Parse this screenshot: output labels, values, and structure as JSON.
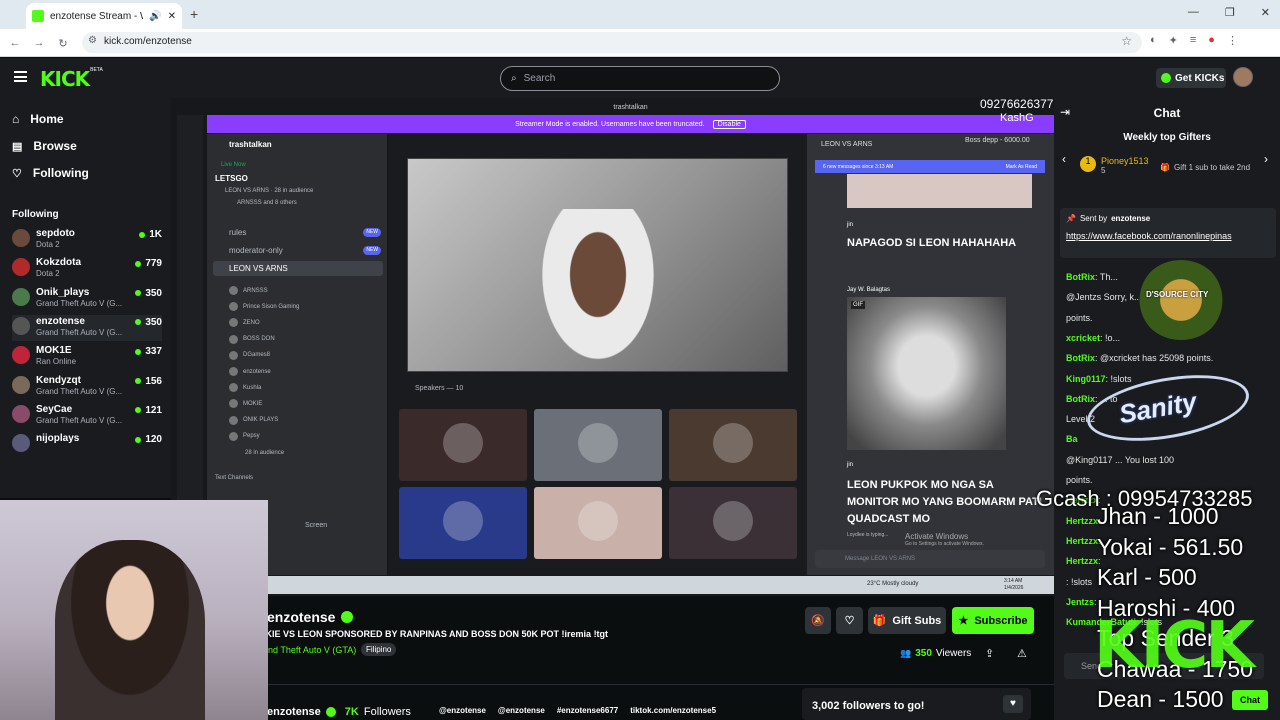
{
  "browser": {
    "tab_title": "enzotense Stream - Watch L",
    "url": "kick.com/enzotense"
  },
  "header": {
    "logo": "KICK",
    "logo_sup": "BETA",
    "search_placeholder": "Search",
    "get_kicks": "Get KICKs"
  },
  "sidebar": {
    "nav": [
      {
        "label": "Home",
        "icon": "home-icon"
      },
      {
        "label": "Browse",
        "icon": "browse-icon"
      },
      {
        "label": "Following",
        "icon": "heart-icon"
      }
    ],
    "following_title": "Following",
    "following": [
      {
        "name": "sepdoto",
        "game": "Dota 2",
        "viewers": "1K",
        "color": "#6a4a3a"
      },
      {
        "name": "Kokzdota",
        "game": "Dota 2",
        "viewers": "779",
        "color": "#b02a2a"
      },
      {
        "name": "Onik_plays",
        "game": "Grand Theft Auto V (G...",
        "viewers": "350",
        "color": "#4a7a4a"
      },
      {
        "name": "enzotense",
        "game": "Grand Theft Auto V (G...",
        "viewers": "350",
        "color": "#555"
      },
      {
        "name": "MOK1E",
        "game": "Ran Online",
        "viewers": "337",
        "color": "#c0243a"
      },
      {
        "name": "Kendyzqt",
        "game": "Grand Theft Auto V (G...",
        "viewers": "156",
        "color": "#7a6a5a"
      },
      {
        "name": "SeyCae",
        "game": "Grand Theft Auto V (G...",
        "viewers": "121",
        "color": "#8a4a6a"
      },
      {
        "name": "nijoplays",
        "game": "",
        "viewers": "120",
        "color": "#5a5a7a"
      }
    ]
  },
  "stream": {
    "phone_overlay": "09276626377",
    "kash_overlay": "KashG",
    "banner_text": "Streamer Mode is enabled. Usernames have been truncated.",
    "banner_button": "Disable",
    "discord": {
      "server": "trashtalkan",
      "live_label": "Live Now",
      "event_title": "LETSGO",
      "event_sub": "LEON VS ARNS · 28 in audience",
      "event_sub2": "ARNSSS and 8 others",
      "channels": [
        "rules",
        "moderator-only",
        "LEON VS ARNS"
      ],
      "new_badge": "NEW",
      "voice_members": [
        "ARNSSS",
        "Prince Sison Gaming",
        "ZENO",
        "BOSS DON",
        "DGames8",
        "enzotense",
        "Kushla",
        "MOKIE",
        "ONIK PLAYS",
        "Pepsy"
      ],
      "audience": "28 in audience",
      "text_channels": "Text Channels",
      "speakers": "Speakers — 10",
      "chat_title": "LEON VS ARNS",
      "new_messages": "6 new messages since 3:13 AM",
      "mark_read": "Mark As Read",
      "messages": [
        {
          "user": "jin",
          "time": "3:13 AM",
          "text": "NAPAGOD SI LEON HAHAHAHA"
        },
        {
          "user": "Jay W. Balagtas",
          "time": "3:14 AM",
          "text": "GIF"
        },
        {
          "user": "jin",
          "time": "3:14 AM",
          "text": "LEON PUKPOK MO NGA SA MONITOR MO YANG BOOMARM PATI QUADCAST MO"
        }
      ],
      "typing": "Loydlee is typing...",
      "activate_windows": "Activate Windows",
      "activate_sub": "Go to Settings to activate Windows.",
      "message_placeholder": "Message LEON VS ARNS",
      "boss_overlay": "Boss depp - 6000.00",
      "screen_label": "Screen"
    },
    "taskbar": {
      "weather": "23°C Mostly cloudy",
      "time": "3:14 AM",
      "date": "1/4/2026"
    }
  },
  "channel": {
    "name": "enzotense",
    "title": "MOKIE VS LEON SPONSORED BY RANPINAS AND BOSS DON 50K POT !iremia !tgt",
    "category": "Grand Theft Auto V (GTA)",
    "tag": "Filipino",
    "viewers": "350",
    "viewers_label": "Viewers",
    "gift_subs": "Gift Subs",
    "subscribe": "Subscribe",
    "followers_count": "7K",
    "followers_label": "Followers",
    "socials": [
      "@enzotense",
      "@enzotense",
      "#enzotense6677",
      "tiktok.com/enzotense5"
    ],
    "goal": "3,002 followers to go!"
  },
  "chat": {
    "title": "Chat",
    "weekly_title": "Weekly top Gifters",
    "top_gifter": "Pioney1513",
    "top_gifter_count": "5",
    "gift_prompt": "Gift 1 sub to take 2nd",
    "pinned_sent_by": "Sent by",
    "pinned_user": "enzotense",
    "pinned_link": "https://www.facebook.com/ranonlinepinas",
    "messages": [
      {
        "user": "BotRix",
        "text": ": Th..."
      },
      {
        "user": "",
        "text": "@Jentzs Sorry, k... lost 100"
      },
      {
        "user": "",
        "text": "points."
      },
      {
        "user": "xcricket",
        "text": ": !o..."
      },
      {
        "user": "BotRix",
        "text": ": @xcricket has 25098 points."
      },
      {
        "user": "King0117",
        "text": ": !slots"
      },
      {
        "user": "BotRix",
        "text": ": ... to"
      },
      {
        "user": "",
        "text": "Level 2"
      },
      {
        "user": "Ba",
        "text": ""
      },
      {
        "user": "",
        "text": "@King0117 ... You lost 100"
      },
      {
        "user": "",
        "text": "points."
      },
      {
        "user": "Hertzzx",
        "text": ":"
      },
      {
        "user": "Hertzzx",
        "text": ":"
      },
      {
        "user": "Hertzzx",
        "text": ":"
      },
      {
        "user": "Hertzzx",
        "text": ":"
      },
      {
        "user": "",
        "text": ": !slots"
      },
      {
        "user": "Jentzs",
        "text": ":"
      },
      {
        "user": "KumanderBatuti",
        "text": ": !slots"
      }
    ],
    "send_placeholder": "Send",
    "chat_button": "Chat"
  },
  "overlays": {
    "gcash": "Gcash : 09954733285",
    "donors": [
      "Jhan - 1000",
      "Yokai - 561.50",
      "Karl - 500",
      "Haroshi - 400",
      "Top Sender 3",
      "Chawaa - 1750",
      "Dean - 1500"
    ],
    "kick_big": "KICK",
    "dsource": "D'SOURCE CITY",
    "sanity": "Sanity"
  },
  "colors": {
    "kick_green": "#53fc18",
    "discord_purple": "#8a3cff",
    "discord_blurple": "#5865f2"
  }
}
